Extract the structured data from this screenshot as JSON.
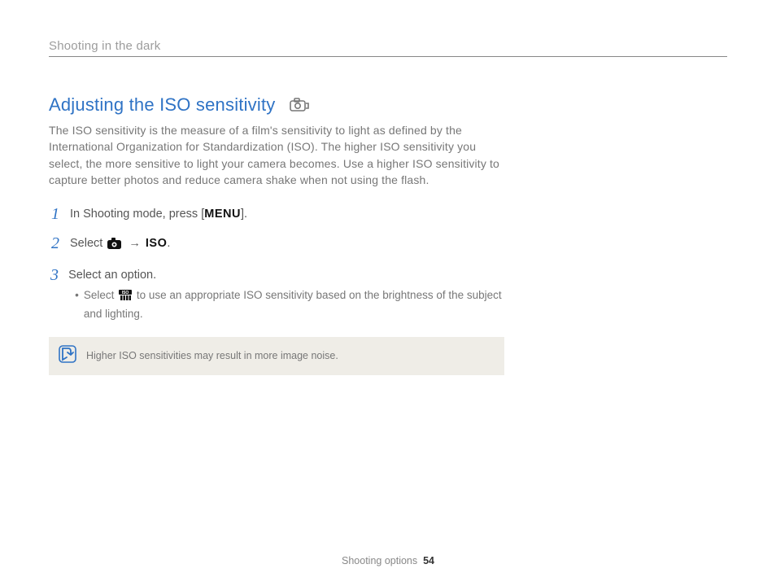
{
  "running_head": "Shooting in the dark",
  "section": {
    "title": "Adjusting the ISO sensitivity",
    "title_icon": "camera-outline-icon",
    "intro": "The ISO sensitivity is the measure of a film's sensitivity to light as defined by the International Organization for Standardization (ISO). The higher ISO sensitivity you select, the more sensitive to light your camera becomes. Use a higher ISO sensitivity to capture better photos and reduce camera shake when not using the flash."
  },
  "steps": [
    {
      "num": "1",
      "pre": "In Shooting mode, press [",
      "menu": "MENU",
      "post": "]."
    },
    {
      "num": "2",
      "pre": "Select ",
      "arrow": "→",
      "iso": "ISO",
      "post": "."
    },
    {
      "num": "3",
      "text": "Select an option.",
      "bullet": {
        "pre": "Select ",
        "post": " to use an appropriate ISO sensitivity based on the brightness of the subject and lighting."
      }
    }
  ],
  "note": {
    "text": "Higher ISO sensitivities may result in more image noise."
  },
  "footer": {
    "label": "Shooting options",
    "page": "54"
  }
}
